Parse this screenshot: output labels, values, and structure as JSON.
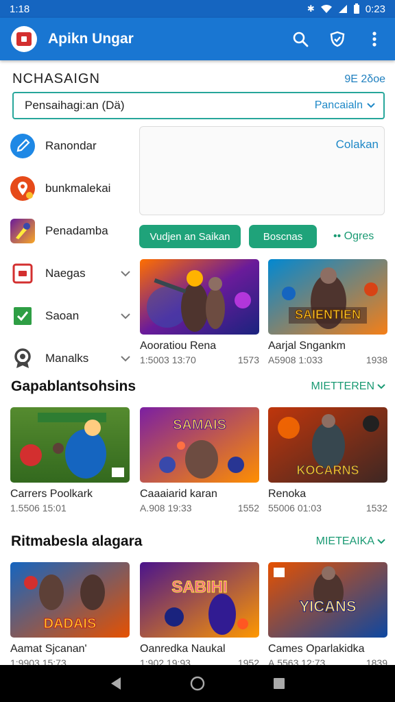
{
  "status_bar": {
    "time": "1:18",
    "clock": "0:23"
  },
  "app_bar": {
    "title": "Apikn Ungar",
    "actions": [
      "search-icon",
      "shield-icon",
      "more-vert-icon"
    ]
  },
  "section": {
    "title": "ΝCΗΑSΑΙGΝ",
    "count": "9Ε 2δοe"
  },
  "search": {
    "value": "Pensaihagi:an (Dä)",
    "dropdown_label": "Pancaialn"
  },
  "sidebar": {
    "items": [
      {
        "label": "Ranondar",
        "icon": "pencil-icon"
      },
      {
        "label": "bunkmalekai",
        "icon": "location-pin-icon"
      },
      {
        "label": "Penadamba",
        "icon": "game-art-icon"
      },
      {
        "label": "Naegas",
        "icon": "video-box-icon",
        "chevron": "⌄"
      },
      {
        "label": "Saoan",
        "icon": "checkbox-icon",
        "chevron": "⌄"
      },
      {
        "label": "Manalks",
        "icon": "badge-icon",
        "chevron": "⌄"
      }
    ]
  },
  "panel": {
    "link": "Colakan"
  },
  "chips": {
    "primary": "Vudjen an Saikan",
    "secondary": "Boscnas",
    "link": "•• Ogres"
  },
  "featured_cards": [
    {
      "title": "Aooratiou Rena",
      "meta_left": "1:5003 13:70",
      "meta_right": "1573",
      "image_text": ""
    },
    {
      "title": "Aarjal Sngankm",
      "meta_left": "A5908 1:033",
      "meta_right": "1938",
      "image_text": "SAIENTIEN"
    }
  ],
  "row1": {
    "title": "Gapablantsohsins",
    "more": "MIETTEREN",
    "cards": [
      {
        "title": "Carrers Poolkark",
        "meta_left": "1.5506 15:01",
        "meta_right": "",
        "image_text": ""
      },
      {
        "title": "Caaaiarid karan",
        "meta_left": "A.908 19:33",
        "meta_right": "1552",
        "image_text": "SAMAIS"
      },
      {
        "title": "Renoka",
        "meta_left": "55006 01:03",
        "meta_right": "1532",
        "image_text": "KOCARNS"
      }
    ]
  },
  "row2": {
    "title": "Ritmabesla alagara",
    "more": "MIETEAIKA",
    "cards": [
      {
        "title": "Aamat Sjcanan'",
        "meta_left": "1:9903 15:73",
        "meta_right": "",
        "image_text": "DADAIS"
      },
      {
        "title": "Oanredka Naukal",
        "meta_left": "1:902 19:93",
        "meta_right": "1952",
        "image_text": "SABIHI"
      },
      {
        "title": "Cames Oparlakidka",
        "meta_left": "A.5563 12:73",
        "meta_right": "1839",
        "image_text": "YICANS"
      }
    ]
  },
  "colors": {
    "appbar": "#1976d2",
    "status": "#1565c0",
    "accent_green": "#1fa37a",
    "teal_border": "#26a69a",
    "link_blue": "#1e88c7"
  }
}
